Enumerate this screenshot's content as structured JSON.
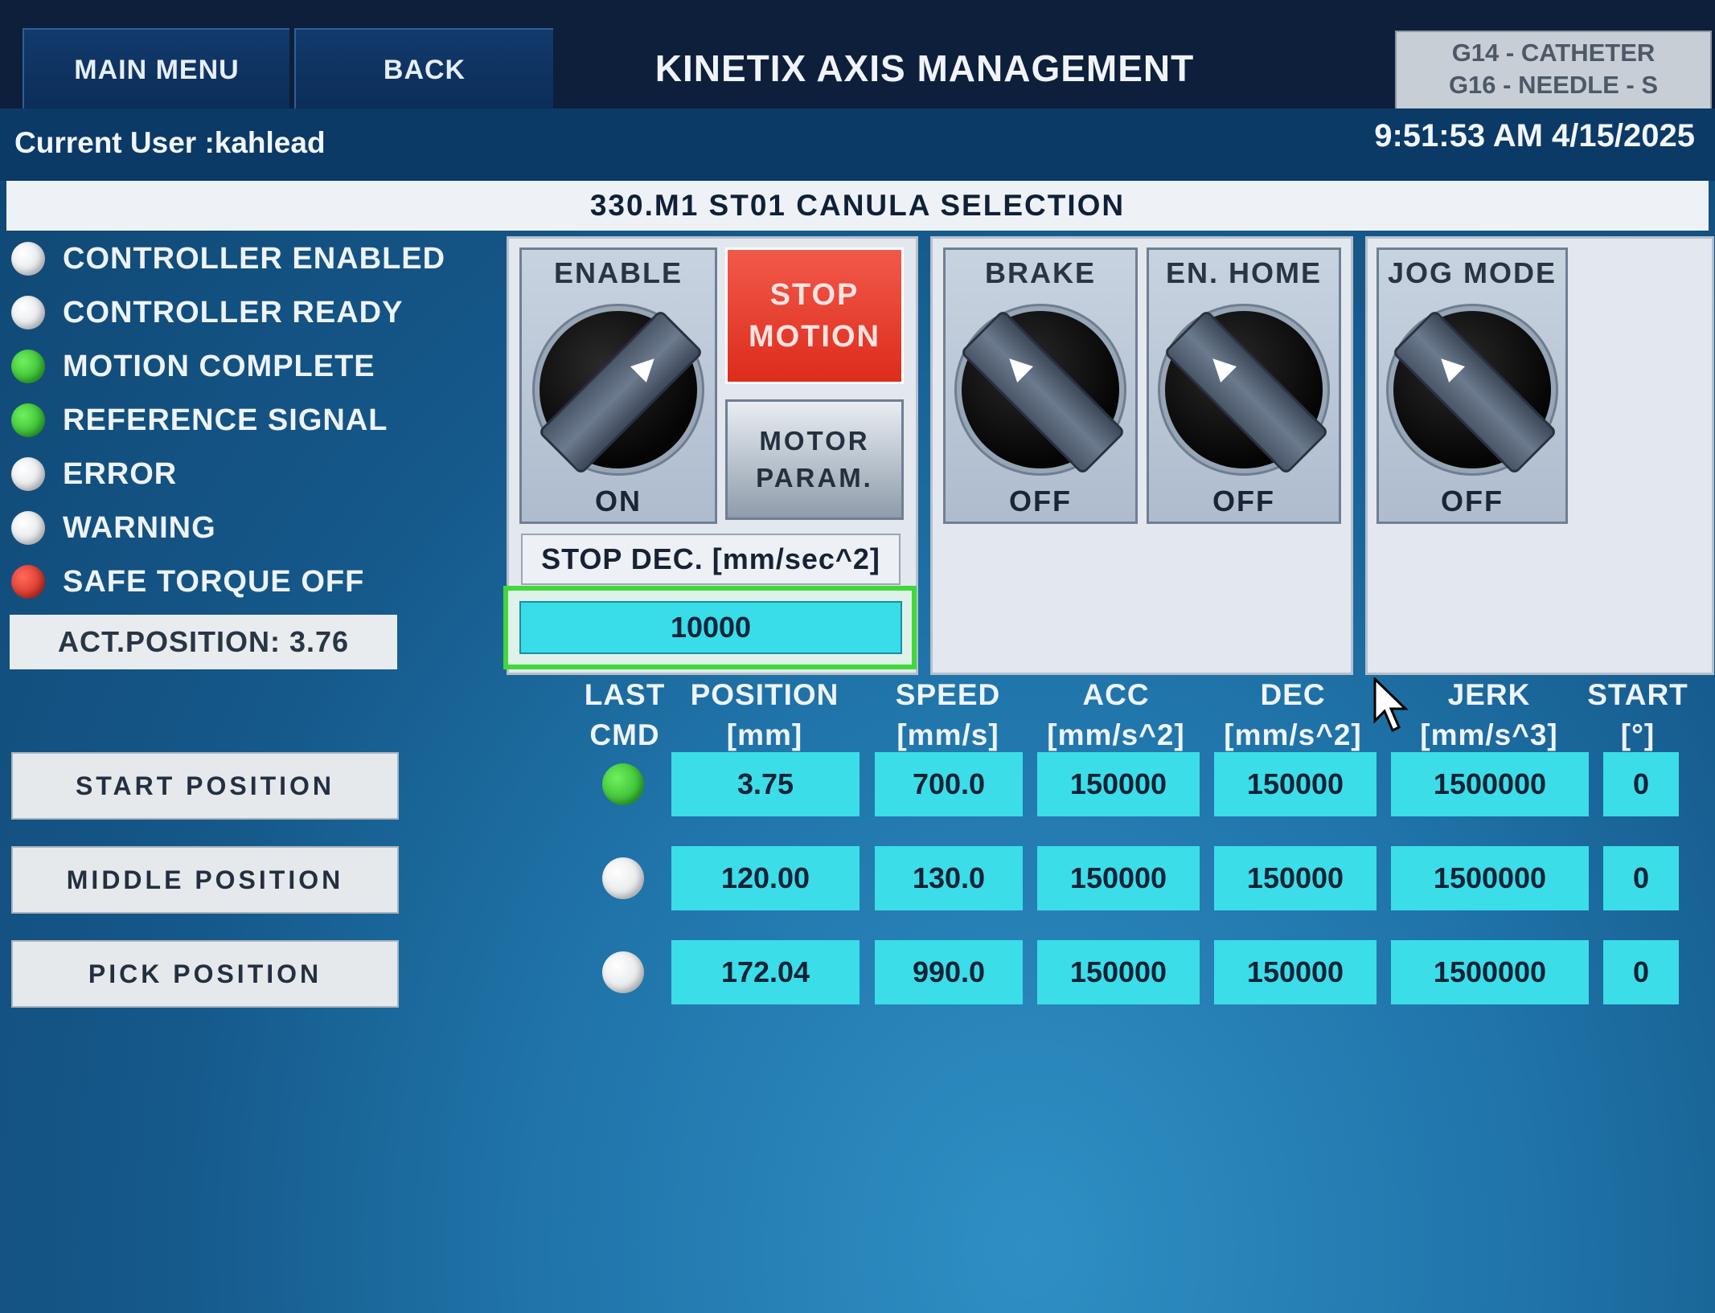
{
  "header": {
    "main_menu_label": "MAIN MENU",
    "back_label": "BACK",
    "title": "KINETIX AXIS MANAGEMENT",
    "recipe_line1": "G14 - CATHETER",
    "recipe_line2": "G16 - NEEDLE - S"
  },
  "user_bar": {
    "current_user": "Current User :kahlead",
    "datetime": "9:51:53 AM 4/15/2025"
  },
  "station": "330.M1  ST01  CANULA SELECTION",
  "status_list": [
    {
      "label": "CONTROLLER ENABLED",
      "state": "white"
    },
    {
      "label": "CONTROLLER READY",
      "state": "white"
    },
    {
      "label": "MOTION COMPLETE",
      "state": "green"
    },
    {
      "label": "REFERENCE SIGNAL",
      "state": "green"
    },
    {
      "label": "ERROR",
      "state": "white"
    },
    {
      "label": "WARNING",
      "state": "white"
    },
    {
      "label": "SAFE TORQUE OFF",
      "state": "red"
    }
  ],
  "act_position": "ACT.POSITION: 3.76",
  "selectors": {
    "enable": {
      "title": "ENABLE",
      "state": "ON"
    },
    "brake": {
      "title": "BRAKE",
      "state": "OFF"
    },
    "en_home": {
      "title": "EN. HOME",
      "state": "OFF"
    },
    "jog_mode": {
      "title": "JOG MODE",
      "state": "OFF"
    }
  },
  "buttons": {
    "stop_line1": "STOP",
    "stop_line2": "MOTION",
    "motor_line1": "MOTOR",
    "motor_line2": "PARAM."
  },
  "stop_dec": {
    "label": "STOP DEC. [mm/sec^2]",
    "value": "10000"
  },
  "table": {
    "headers": [
      {
        "l1": "LAST",
        "l2": "CMD"
      },
      {
        "l1": "POSITION",
        "l2": "[mm]"
      },
      {
        "l1": "SPEED",
        "l2": "[mm/s]"
      },
      {
        "l1": "ACC",
        "l2": "[mm/s^2]"
      },
      {
        "l1": "DEC",
        "l2": "[mm/s^2]"
      },
      {
        "l1": "JERK",
        "l2": "[mm/s^3]"
      },
      {
        "l1": "START",
        "l2": "[°]"
      }
    ],
    "rows": [
      {
        "button": "START POSITION",
        "last_cmd": "green",
        "position": "3.75",
        "speed": "700.0",
        "acc": "150000",
        "dec": "150000",
        "jerk": "1500000",
        "start": "0"
      },
      {
        "button": "MIDDLE POSITION",
        "last_cmd": "white",
        "position": "120.00",
        "speed": "130.0",
        "acc": "150000",
        "dec": "150000",
        "jerk": "1500000",
        "start": "0"
      },
      {
        "button": "PICK POSITION",
        "last_cmd": "white",
        "position": "172.04",
        "speed": "990.0",
        "acc": "150000",
        "dec": "150000",
        "jerk": "1500000",
        "start": "0"
      }
    ]
  },
  "colors": {
    "led_green": "#2bc42a",
    "led_red": "#e0281a",
    "led_white": "#f2f2f2",
    "cell_cyan": "#3bdde8",
    "stop_red": "#e63a2a"
  }
}
